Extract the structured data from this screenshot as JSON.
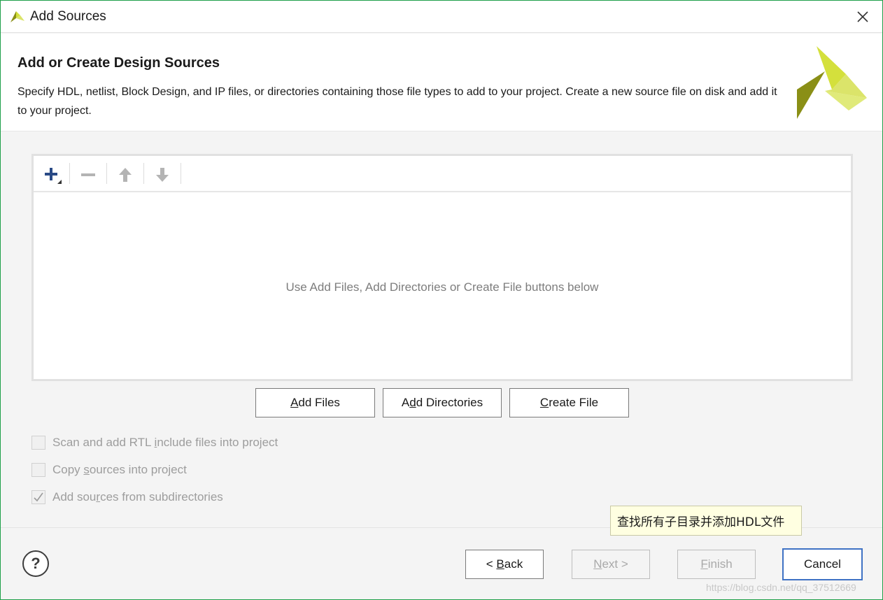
{
  "window": {
    "title": "Add Sources",
    "close_icon": "close-icon"
  },
  "header": {
    "heading": "Add or Create Design Sources",
    "description": "Specify HDL, netlist, Block Design, and IP files, or directories containing those file types to add to your project. Create a new source file on disk and add it to your project."
  },
  "toolbar": {
    "icons": [
      "plus-icon",
      "minus-icon",
      "arrow-up-icon",
      "arrow-down-icon"
    ]
  },
  "file_list": {
    "empty_message": "Use Add Files, Add Directories or Create File buttons below"
  },
  "actions": {
    "add_files": {
      "mn": "A",
      "rest": "dd Files"
    },
    "add_directories": {
      "pre": "A",
      "mn": "d",
      "rest": "d Directories"
    },
    "create_file": {
      "mn": "C",
      "rest": "reate File"
    }
  },
  "options": {
    "scan_rtl": {
      "pre": "Scan and add RTL ",
      "mn": "i",
      "rest": "nclude files into project",
      "checked": false
    },
    "copy_sources": {
      "pre": "Copy ",
      "mn": "s",
      "rest": "ources into project",
      "checked": false
    },
    "subdirectories": {
      "pre": "Add sou",
      "mn": "r",
      "rest": "ces from subdirectories",
      "checked": true
    }
  },
  "tooltip": "查找所有子目录并添加HDL文件",
  "footer": {
    "help": "?",
    "back": {
      "pre": "< ",
      "mn": "B",
      "rest": "ack"
    },
    "next": {
      "mn": "N",
      "rest": "ext >"
    },
    "finish": {
      "mn": "F",
      "rest": "inish"
    },
    "cancel": "Cancel"
  },
  "watermark": "https://blog.csdn.net/qq_37512669",
  "colors": {
    "window_border": "#1fa04a",
    "logo_light": "#d4e03c",
    "logo_dark": "#8a8f16",
    "primary_border": "#3f72c4",
    "tooltip_bg": "#ffffe1"
  }
}
